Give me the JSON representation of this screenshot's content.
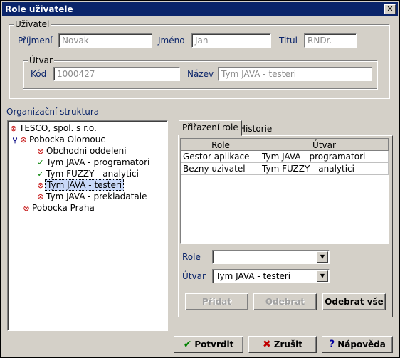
{
  "window": {
    "title": "Role uživatele",
    "close_label": "✕"
  },
  "user": {
    "group_label": "Uživatel",
    "surname_label": "Příjmení",
    "surname_value": "Novak",
    "name_label": "Jméno",
    "name_value": "Jan",
    "title_label": "Titul",
    "title_value": "RNDr."
  },
  "unit": {
    "group_label": "Útvar",
    "code_label": "Kód",
    "code_value": "1000427",
    "name_label": "Název",
    "name_value": "Tym JAVA - testeri"
  },
  "org": {
    "label": "Organizační struktura",
    "nodes": [
      {
        "text": "TESCO, spol. s r.o.",
        "icon": "error-x-icon"
      },
      {
        "text": "Pobocka Olomouc",
        "icon": "error-x-icon"
      },
      {
        "text": "Obchodni oddeleni",
        "icon": "error-x-icon"
      },
      {
        "text": "Tym JAVA - programatori",
        "icon": "checkmark-icon"
      },
      {
        "text": "Tym FUZZY - analytici",
        "icon": "checkmark-icon"
      },
      {
        "text": "Tym JAVA - testeri",
        "icon": "error-x-icon"
      },
      {
        "text": "Tym JAVA - prekladatale",
        "icon": "error-x-icon"
      },
      {
        "text": "Pobocka Praha",
        "icon": "error-x-icon"
      }
    ]
  },
  "tabs": [
    {
      "label": "Přiřazení role"
    },
    {
      "label": "Historie"
    }
  ],
  "grid": {
    "columns": [
      "Role",
      "Útvar"
    ],
    "rows": [
      [
        "Gestor aplikace",
        "Tym JAVA - programatori"
      ],
      [
        "Bezny uzivatel",
        "Tym FUZZY - analytici"
      ]
    ]
  },
  "form": {
    "role_label": "Role",
    "role_value": "",
    "unit_label": "Útvar",
    "unit_value": "Tym JAVA - testeri"
  },
  "actions": {
    "add": "Přidat",
    "remove": "Odebrat",
    "remove_all": "Odebrat vše"
  },
  "footer": {
    "confirm": "Potvrdit",
    "cancel": "Zrušit",
    "help": "Nápověda"
  }
}
